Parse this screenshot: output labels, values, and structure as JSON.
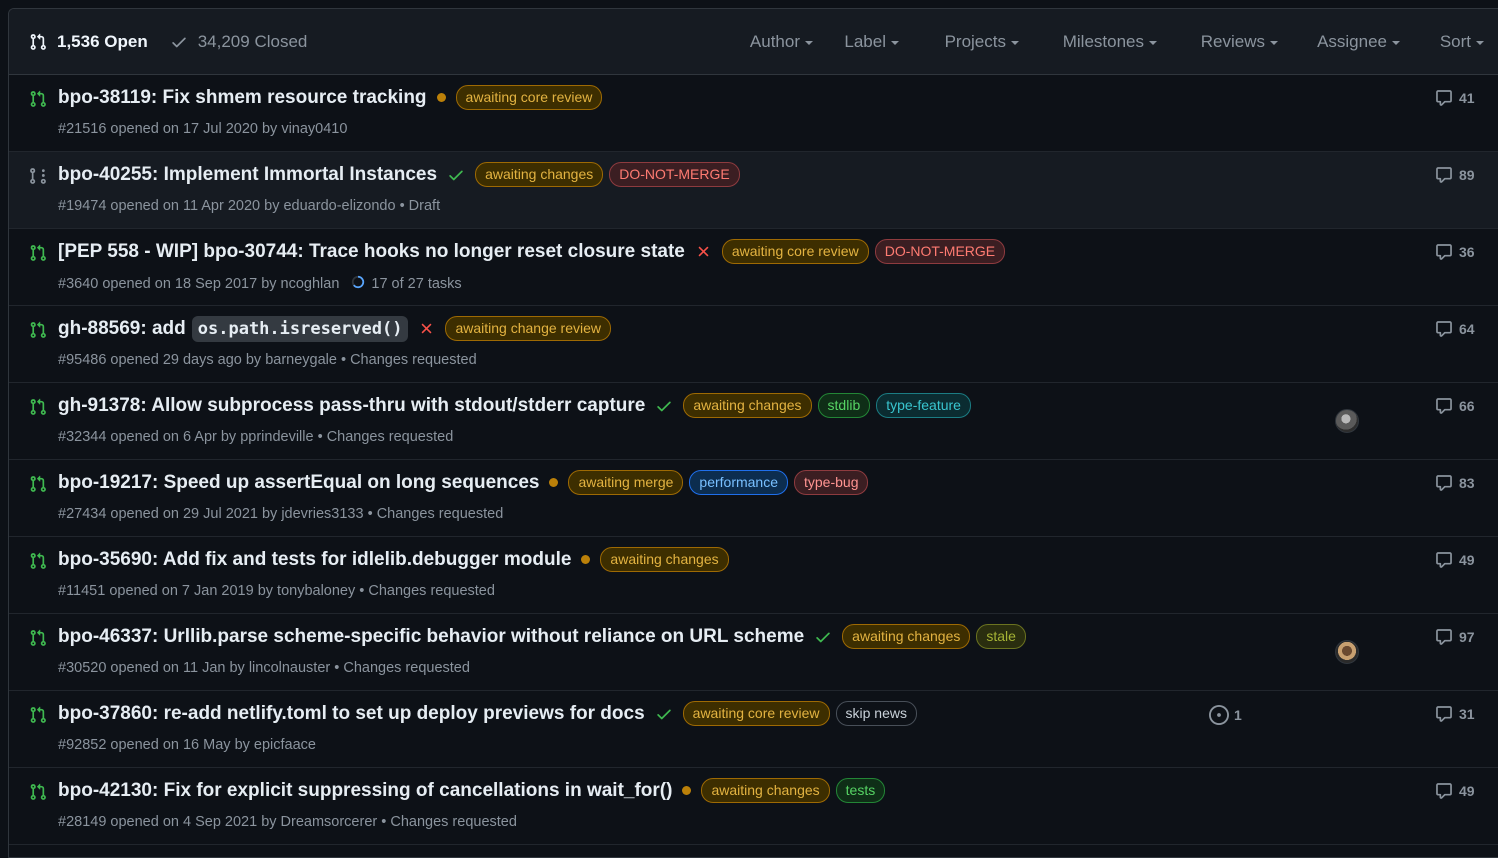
{
  "header": {
    "open_count": "1,536 Open",
    "closed_count": "34,209 Closed",
    "filters": [
      "Author",
      "Label",
      "Projects",
      "Milestones",
      "Reviews",
      "Assignee",
      "Sort"
    ]
  },
  "colors": {
    "background": "#0d1117",
    "open_icon": "#3fb950",
    "draft_icon": "#8b949e",
    "pending_dot": "#bb8009",
    "success_check": "#3fb950",
    "failure_x": "#f85149"
  },
  "pulls": [
    {
      "title": "bpo-38119: Fix shmem resource tracking",
      "status": "pending",
      "labels": [
        {
          "text": "awaiting core review",
          "fg": "#e3b341",
          "bg": "#3d2e00",
          "border": "#9e6a03"
        }
      ],
      "meta": "#21516 opened on 17 Jul 2020 by vinay0410",
      "comments": "41",
      "icon": "open-pr"
    },
    {
      "title": "bpo-40255: Implement Immortal Instances",
      "status": "success",
      "labels": [
        {
          "text": "awaiting changes",
          "fg": "#e3b341",
          "bg": "#3d2e00",
          "border": "#9e6a03"
        },
        {
          "text": "DO-NOT-MERGE",
          "fg": "#ff7b72",
          "bg": "#3b1e22",
          "border": "#8e3b3f"
        }
      ],
      "meta": "#19474 opened on 11 Apr 2020 by eduardo-elizondo • Draft",
      "comments": "89",
      "icon": "draft-pr"
    },
    {
      "title": "[PEP 558 - WIP] bpo-30744: Trace hooks no longer reset closure state",
      "status": "failure",
      "labels": [
        {
          "text": "awaiting core review",
          "fg": "#e3b341",
          "bg": "#3d2e00",
          "border": "#9e6a03"
        },
        {
          "text": "DO-NOT-MERGE",
          "fg": "#ff7b72",
          "bg": "#3b1e22",
          "border": "#8e3b3f"
        }
      ],
      "meta": "#3640 opened on 18 Sep 2017 by ncoghlan",
      "tasks": "17 of 27 tasks",
      "comments": "36",
      "icon": "open-pr"
    },
    {
      "title_prefix": "gh-88569: add",
      "title_code": "os.path.isreserved()",
      "status": "failure",
      "labels": [
        {
          "text": "awaiting change review",
          "fg": "#e3b341",
          "bg": "#3d2e00",
          "border": "#9e6a03"
        }
      ],
      "meta": "#95486 opened 29 days ago by barneygale • Changes requested",
      "comments": "64",
      "icon": "open-pr"
    },
    {
      "title": "gh-91378: Allow subprocess pass-thru with stdout/stderr capture",
      "status": "success",
      "labels": [
        {
          "text": "awaiting changes",
          "fg": "#e3b341",
          "bg": "#3d2e00",
          "border": "#9e6a03"
        },
        {
          "text": "stdlib",
          "fg": "#56d364",
          "bg": "#0f2e17",
          "border": "#238636"
        },
        {
          "text": "type-feature",
          "fg": "#39c5cf",
          "bg": "#0b2c31",
          "border": "#1b7c83"
        }
      ],
      "meta": "#32344 opened on 6 Apr by pprindeville • Changes requested",
      "comments": "66",
      "avatar": "a",
      "icon": "open-pr"
    },
    {
      "title": "bpo-19217: Speed up assertEqual on long sequences",
      "status": "pending",
      "labels": [
        {
          "text": "awaiting merge",
          "fg": "#e3b341",
          "bg": "#3d2e00",
          "border": "#9e6a03"
        },
        {
          "text": "performance",
          "fg": "#79c0ff",
          "bg": "#0c2d4f",
          "border": "#1f6feb"
        },
        {
          "text": "type-bug",
          "fg": "#ff9492",
          "bg": "#3b1e22",
          "border": "#8e3b3f"
        }
      ],
      "meta": "#27434 opened on 29 Jul 2021 by jdevries3133 • Changes requested",
      "comments": "83",
      "icon": "open-pr"
    },
    {
      "title": "bpo-35690: Add fix and tests for idlelib.debugger module",
      "status": "pending",
      "labels": [
        {
          "text": "awaiting changes",
          "fg": "#e3b341",
          "bg": "#3d2e00",
          "border": "#9e6a03"
        }
      ],
      "meta": "#11451 opened on 7 Jan 2019 by tonybaloney • Changes requested",
      "comments": "49",
      "icon": "open-pr"
    },
    {
      "title": "bpo-46337: Urllib.parse scheme-specific behavior without reliance on URL scheme",
      "status": "success",
      "labels": [
        {
          "text": "awaiting changes",
          "fg": "#e3b341",
          "bg": "#3d2e00",
          "border": "#9e6a03"
        },
        {
          "text": "stale",
          "fg": "#a5b335",
          "bg": "#2a2e0f",
          "border": "#6b7320"
        }
      ],
      "meta": "#30520 opened on 11 Jan by lincolnauster • Changes requested",
      "comments": "97",
      "avatar": "b",
      "icon": "open-pr"
    },
    {
      "title": "bpo-37860: re-add netlify.toml to set up deploy previews for docs",
      "status": "success",
      "labels": [
        {
          "text": "awaiting core review",
          "fg": "#e3b341",
          "bg": "#3d2e00",
          "border": "#9e6a03"
        },
        {
          "text": "skip news",
          "fg": "#c9d1d9",
          "bg": "#0d1117",
          "border": "#484f58"
        }
      ],
      "meta": "#92852 opened on 16 May by epicfaace",
      "linked_issues": "1",
      "comments": "31",
      "icon": "open-pr"
    },
    {
      "title": "bpo-42130: Fix for explicit suppressing of cancellations in wait_for()",
      "status": "pending",
      "labels": [
        {
          "text": "awaiting changes",
          "fg": "#e3b341",
          "bg": "#3d2e00",
          "border": "#9e6a03"
        },
        {
          "text": "tests",
          "fg": "#56d364",
          "bg": "#0f2e17",
          "border": "#238636"
        }
      ],
      "meta": "#28149 opened on 4 Sep 2021 by Dreamsorcerer • Changes requested",
      "comments": "49",
      "icon": "open-pr"
    }
  ]
}
